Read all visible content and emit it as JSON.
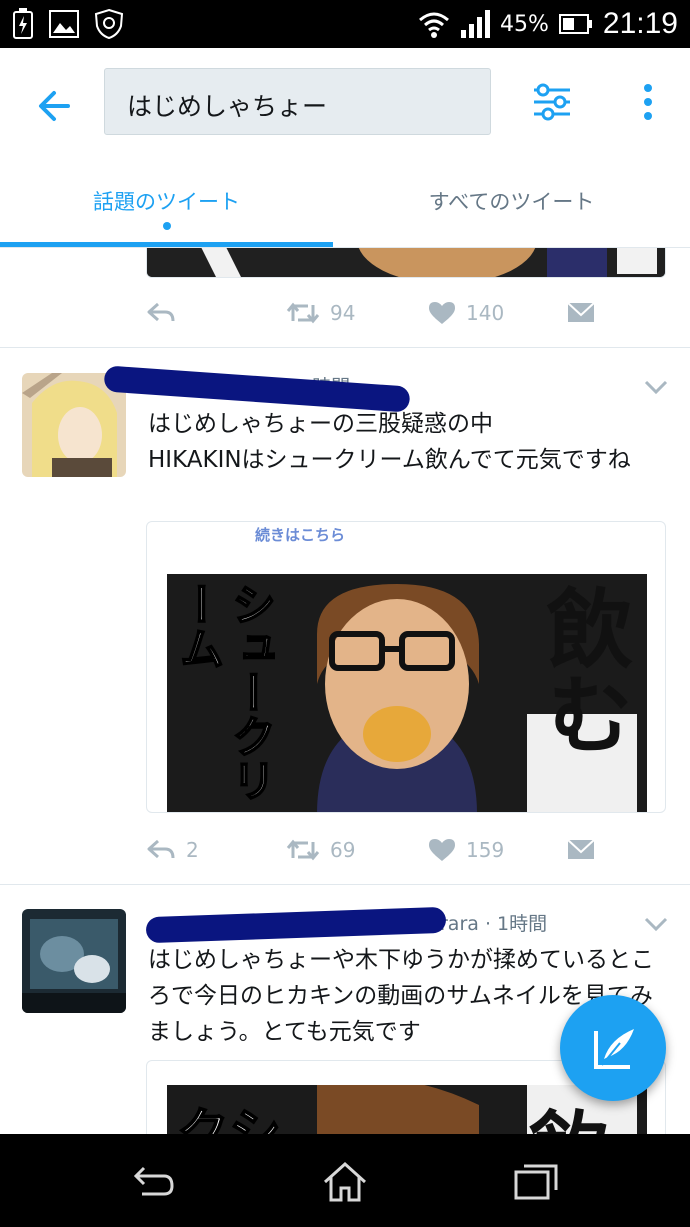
{
  "status_bar": {
    "battery_percent": "45%",
    "time": "21:19"
  },
  "search": {
    "query": "はじめしゃちょー"
  },
  "tabs": [
    {
      "label": "話題のツイート",
      "active": true
    },
    {
      "label": "すべてのツイート",
      "active": false
    }
  ],
  "tweets": [
    {
      "replies": "",
      "retweets": "94",
      "likes": "140"
    },
    {
      "meta": "· 1時間",
      "text": "はじめしゃちょーの三股疑惑の中\nHIKAKINはシュークリーム飲んでて元気ですね",
      "image_caption": "続きはこちら",
      "image_text_left": "シュークリーム",
      "image_text_right": "飲む",
      "replies": "2",
      "retweets": "69",
      "likes": "159"
    },
    {
      "meta": "rara · 1時間",
      "text": "はじめしゃちょーや木下ゆうかが揉めているところで今日のヒカキンの動画のサムネイルを見てみましょう。とても元気です",
      "image_text_left": "クシ",
      "image_text_right": "飲"
    }
  ],
  "colors": {
    "accent": "#1da1f2",
    "muted": "#aab8c2",
    "redaction": "#0a1580"
  },
  "icons": [
    "back-arrow-icon",
    "filter-icon",
    "more-vert-icon",
    "reply-icon",
    "retweet-icon",
    "heart-icon",
    "dm-icon",
    "chevron-down-icon",
    "compose-icon"
  ]
}
